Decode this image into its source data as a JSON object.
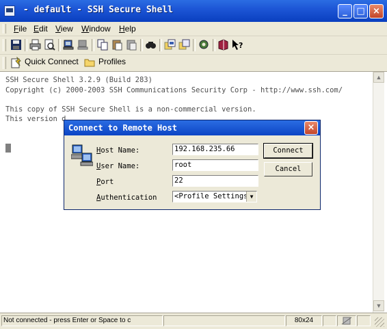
{
  "window": {
    "title": " - default - SSH Secure Shell",
    "minimize": "_",
    "maximize": "□",
    "close": "×"
  },
  "menu": {
    "items": [
      {
        "accel": "F",
        "rest": "ile"
      },
      {
        "accel": "E",
        "rest": "dit"
      },
      {
        "accel": "V",
        "rest": "iew"
      },
      {
        "accel": "W",
        "rest": "indow"
      },
      {
        "accel": "H",
        "rest": "elp"
      }
    ]
  },
  "toolbar": {
    "icons": [
      "save-icon",
      "print-icon",
      "print-preview-icon",
      "connect-icon",
      "disconnect-icon",
      "copy-icon",
      "paste-icon",
      "paste-special-icon",
      "find-icon",
      "file-transfer-icon",
      "new-window-icon",
      "settings-icon",
      "help-book-icon",
      "whats-this-icon"
    ],
    "quick_connect": "Quick Connect",
    "profiles": "Profiles"
  },
  "terminal": {
    "lines": [
      "SSH Secure Shell 3.2.9 (Build 283)",
      "Copyright (c) 2000-2003 SSH Communications Security Corp - http://www.ssh.com/",
      "",
      "This copy of SSH Secure Shell is a non-commercial version.",
      "This version d"
    ]
  },
  "dialog": {
    "title": "Connect to Remote Host",
    "close": "×",
    "fields": [
      {
        "accel": "H",
        "rest": "ost Name:",
        "value": "192.168.235.66"
      },
      {
        "accel": "U",
        "rest": "ser Name:",
        "value": "root"
      },
      {
        "accel": "P",
        "rest": "ort",
        "value": "22"
      },
      {
        "accel": "A",
        "rest": "uthentication",
        "value": "<Profile Settings>"
      }
    ],
    "connect": "Connect",
    "cancel": "Cancel"
  },
  "status": {
    "message": "Not connected - press Enter or Space to c",
    "size": "80x24"
  }
}
